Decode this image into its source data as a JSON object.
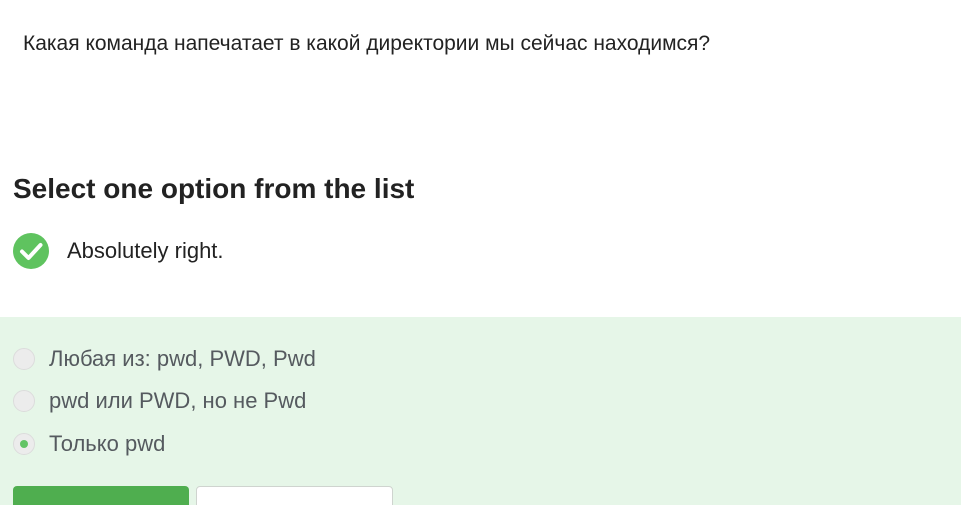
{
  "question": {
    "text": "Какая команда напечатает в какой директории мы сейчас находимся?"
  },
  "quiz": {
    "instruction": "Select one option from the list",
    "feedback": {
      "icon": "check-circle-icon",
      "text": "Absolutely right.",
      "color": "#5fc35f"
    },
    "options": [
      {
        "label": "Любая из: pwd, PWD, Pwd",
        "selected": false
      },
      {
        "label": "pwd или PWD, но не Pwd",
        "selected": false
      },
      {
        "label": "Только pwd",
        "selected": true
      }
    ],
    "panel_color": "#e6f6e8",
    "primary_button_color": "#4fae4f"
  }
}
